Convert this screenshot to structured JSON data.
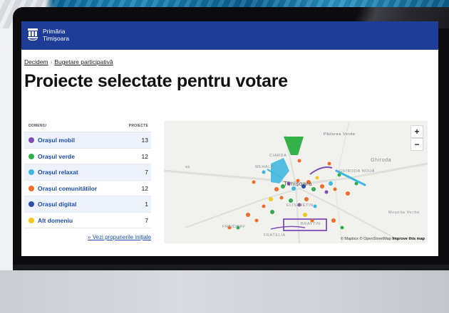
{
  "header": {
    "brand_line1": "Primăria",
    "brand_line2": "Timișoara",
    "bar_color": "#1d3d96"
  },
  "breadcrumb": {
    "items": [
      "Decidem",
      "Bugetare participativă"
    ],
    "separator": "›"
  },
  "page_title": "Proiecte selectate pentru votare",
  "table": {
    "col_domain": "DOMENIU",
    "col_projects": "PROIECTE",
    "rows": [
      {
        "label": "Orașul mobil",
        "count": "13",
        "color": "#7d4fb5"
      },
      {
        "label": "Orașul verde",
        "count": "12",
        "color": "#2fae4e"
      },
      {
        "label": "Orașul relaxat",
        "count": "7",
        "color": "#3fb8e0"
      },
      {
        "label": "Orașul comunitătilor",
        "count": "12",
        "color": "#f06c2a"
      },
      {
        "label": "Orașul digital",
        "count": "1",
        "color": "#2a4fa8"
      },
      {
        "label": "Alt domeniu",
        "count": "7",
        "color": "#f5c518"
      }
    ],
    "more_link": "» Vezi propunerile inițiale"
  },
  "map": {
    "zoom_in": "+",
    "zoom_out": "−",
    "attribution_mapbox": "© Mapbox",
    "attribution_osm": "© OpenStreetMap",
    "attribution_improve": "Improve this map",
    "labels": {
      "padurea": "Pădurea Verde",
      "ghiroda": "Ghiroda",
      "ghiroda_noua": "GHIRODA NOUĂ",
      "timisoara": "Timișoara",
      "mosnita": "Moșnița Veche",
      "freidorf": "FREIDORF",
      "fratelia": "FRATELIA",
      "brattin": "BRAYTIN",
      "elisabetin": "ELISABETIN",
      "mehala": "MEHALA",
      "ciarda": "CIARDA",
      "az": "az"
    }
  }
}
